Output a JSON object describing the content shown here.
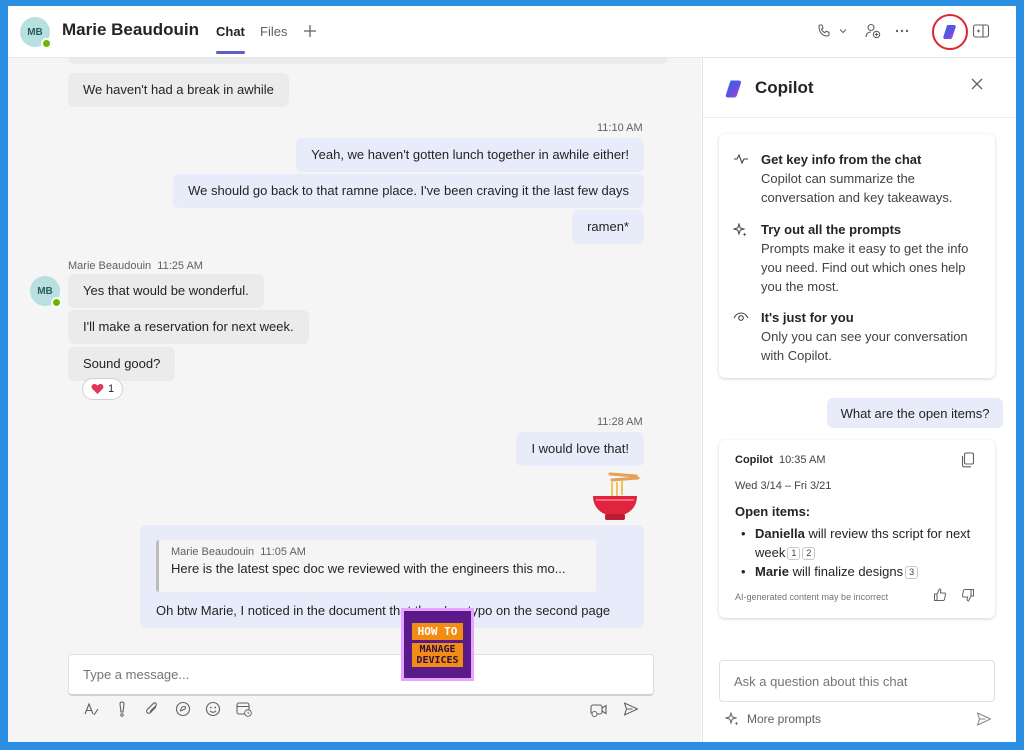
{
  "header": {
    "avatar_initials": "MB",
    "contact_name": "Marie Beaudouin",
    "tabs": [
      {
        "label": "Chat",
        "active": true
      },
      {
        "label": "Files",
        "active": false
      }
    ],
    "add_tab_icon": "plus-icon",
    "icons": [
      "phone-icon",
      "chevron-down-icon",
      "add-people-icon",
      "more-icon",
      "copilot-icon",
      "open-panel-icon"
    ]
  },
  "chat": {
    "messages": [
      {
        "from": "contact",
        "text": "We haven't had a break in awhile"
      },
      {
        "from": "me",
        "time": "11:10 AM",
        "text": "Yeah, we haven't gotten lunch together in awhile either!"
      },
      {
        "from": "me",
        "text": "We should go back to that ramne place. I've been craving it the last few days"
      },
      {
        "from": "me",
        "text": "ramen*"
      },
      {
        "from": "contact",
        "sender": "Marie Beaudouin",
        "time": "11:25 AM",
        "text": "Yes that would be wonderful."
      },
      {
        "from": "contact",
        "text": "I'll make a reservation for next week."
      },
      {
        "from": "contact",
        "text": "Sound good?"
      },
      {
        "from": "me",
        "time": "11:28 AM",
        "text": "I would love that!"
      }
    ],
    "reaction": {
      "icon": "heart-icon",
      "count": "1"
    },
    "quoted": {
      "sender": "Marie Beaudouin",
      "time": "11:05 AM",
      "text": "Here is the latest spec doc we reviewed with the engineers this mo...",
      "reply": "Oh btw Marie, I noticed in the document that there's a typo on the second page"
    },
    "compose_placeholder": "Type a message...",
    "toolbar_icons": [
      "format-icon",
      "priority-icon",
      "attach-icon",
      "loop-icon",
      "emoji-icon",
      "schedule-icon",
      "video-clip-icon",
      "send-icon"
    ]
  },
  "logo": {
    "line1": "HOW TO",
    "line2": "MANAGE",
    "line3": "DEVICES"
  },
  "copilot": {
    "title": "Copilot",
    "intro": [
      {
        "icon": "key-info-icon",
        "title": "Get key info from the chat",
        "desc": "Copilot can summarize the conversation and key takeaways."
      },
      {
        "icon": "sparkle-icon",
        "title": "Try out all the prompts",
        "desc": "Prompts make it easy to get the info you need. Find out which ones help you the most."
      },
      {
        "icon": "eye-icon",
        "title": "It's just for you",
        "desc": "Only you can see your conversation with Copilot."
      }
    ],
    "user_question": "What are the open items?",
    "response": {
      "sender": "Copilot",
      "time": "10:35 AM",
      "date_range": "Wed 3/14 – Fri 3/21",
      "heading": "Open items:",
      "items": [
        {
          "name": "Daniella",
          "text": " will review ths script for next week",
          "cites": [
            "1",
            "2"
          ]
        },
        {
          "name": "Marie",
          "text": " will finalize designs",
          "cites": [
            "3"
          ]
        }
      ],
      "disclaimer": "AI-generated content may be incorrect"
    },
    "ask_placeholder": "Ask a question about this chat",
    "more_prompts": "More prompts"
  }
}
